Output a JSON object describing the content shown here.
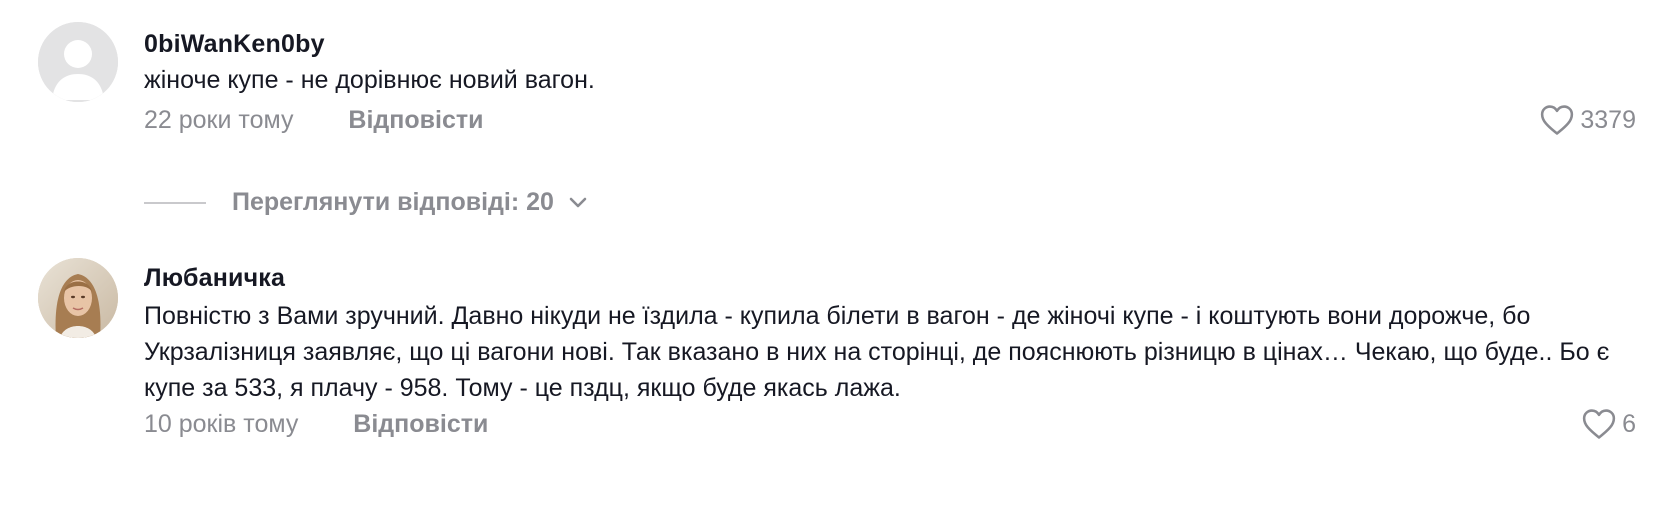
{
  "comments": [
    {
      "author": "0biWanKen0by",
      "text": "жіноче купе - не дорівнює новий вагон.",
      "time": "22 роки тому",
      "reply_label": "Відповісти",
      "likes": "3379",
      "view_replies_label": "Переглянути відповіді: 20",
      "avatar": "default-user-avatar"
    },
    {
      "author": "Любаничка",
      "text": "Повністю з Вами зручний. Давно нікуди не їздила - купила білети в вагон - де жіночі купе - і коштують вони дорожче, бо Укрзалізниця заявляє, що ці вагони нові. Так вказано в них на сторінці, де пояснюють різницю в цінах… Чекаю, що буде.. Бо є купе за 533, я плачу - 958. Тому - це пздц, якщо буде якась лажа.",
      "time": "10 років тому",
      "reply_label": "Відповісти",
      "likes": "6",
      "avatar": "profile-photo-avatar"
    }
  ],
  "icons": {
    "like": "heart-outline-icon",
    "expand": "chevron-down-icon"
  },
  "colors": {
    "text_primary": "#161823",
    "text_secondary": "#8a8b91",
    "avatar_placeholder": "#e3e3e4"
  }
}
